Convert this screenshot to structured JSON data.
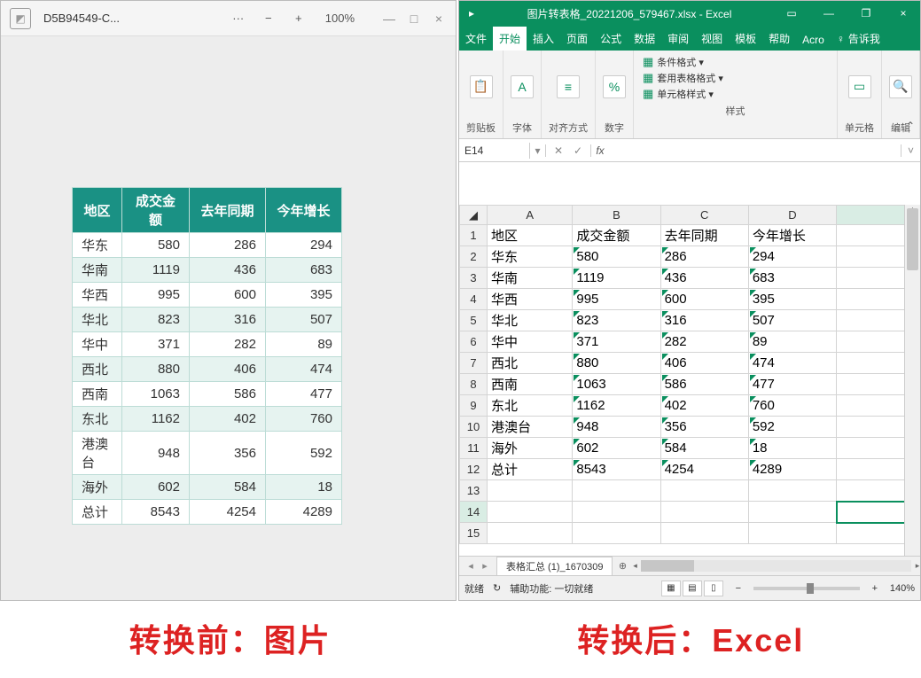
{
  "left": {
    "filename": "D5B94549-C...",
    "more": "···",
    "zoom_out": "−",
    "zoom_in": "+",
    "zoom": "100%",
    "min": "—",
    "max": "□",
    "close": "×",
    "table": {
      "headers": [
        "地区",
        "成交金额",
        "去年同期",
        "今年增长"
      ],
      "rows": [
        [
          "华东",
          "580",
          "286",
          "294"
        ],
        [
          "华南",
          "1119",
          "436",
          "683"
        ],
        [
          "华西",
          "995",
          "600",
          "395"
        ],
        [
          "华北",
          "823",
          "316",
          "507"
        ],
        [
          "华中",
          "371",
          "282",
          "89"
        ],
        [
          "西北",
          "880",
          "406",
          "474"
        ],
        [
          "西南",
          "1063",
          "586",
          "477"
        ],
        [
          "东北",
          "1162",
          "402",
          "760"
        ],
        [
          "港澳台",
          "948",
          "356",
          "592"
        ],
        [
          "海外",
          "602",
          "584",
          "18"
        ],
        [
          "总计",
          "8543",
          "4254",
          "4289"
        ]
      ]
    }
  },
  "excel": {
    "title": "图片转表格_20221206_579467.xlsx - Excel",
    "win_min": "—",
    "win_restore": "❐",
    "win_close": "×",
    "win_acct": "▭",
    "tabs": [
      "文件",
      "开始",
      "插入",
      "页面",
      "公式",
      "数据",
      "审阅",
      "视图",
      "模板",
      "帮助",
      "Acro"
    ],
    "tell_icon": "♀",
    "tell": "告诉我",
    "ribbon": {
      "clipboard": {
        "icon": "📋",
        "label": "剪贴板"
      },
      "font": {
        "icon": "A",
        "label": "字体"
      },
      "align": {
        "icon": "≡",
        "label": "对齐方式"
      },
      "number": {
        "icon": "%",
        "label": "数字"
      },
      "styles": {
        "cond": "条件格式 ▾",
        "table": "套用表格格式 ▾",
        "cell": "单元格样式 ▾",
        "label": "样式",
        "i1": "▦",
        "i2": "▦",
        "i3": "▦"
      },
      "cells": {
        "icon": "▭",
        "label": "单元格"
      },
      "edit": {
        "icon": "🔍",
        "label": "编辑"
      },
      "collapse": "⌃"
    },
    "namebox": {
      "cell": "E14",
      "drop": "▾",
      "cancel": "✕",
      "ok": "✓",
      "fx": "fx",
      "value": "",
      "expand": "˅"
    },
    "colheads": [
      "A",
      "B",
      "C",
      "D"
    ],
    "data": {
      "headers": [
        "地区",
        "成交金额",
        "去年同期",
        "今年增长"
      ],
      "rows": [
        [
          "华东",
          "580",
          "286",
          "294"
        ],
        [
          "华南",
          "1119",
          "436",
          "683"
        ],
        [
          "华西",
          "995",
          "600",
          "395"
        ],
        [
          "华北",
          "823",
          "316",
          "507"
        ],
        [
          "华中",
          "371",
          "282",
          "89"
        ],
        [
          "西北",
          "880",
          "406",
          "474"
        ],
        [
          "西南",
          "1063",
          "586",
          "477"
        ],
        [
          "东北",
          "1162",
          "402",
          "760"
        ],
        [
          "港澳台",
          "948",
          "356",
          "592"
        ],
        [
          "海外",
          "602",
          "584",
          "18"
        ],
        [
          "总计",
          "8543",
          "4254",
          "4289"
        ]
      ]
    },
    "rownums": [
      "1",
      "2",
      "3",
      "4",
      "5",
      "6",
      "7",
      "8",
      "9",
      "10",
      "11",
      "12",
      "13",
      "14",
      "15"
    ],
    "sheet": {
      "name": "表格汇总 (1)_1670309",
      "add": "⊕",
      "navl": "◂",
      "navr": "▸",
      "harrl": "◂",
      "harrr": "▸"
    },
    "status": {
      "ready": "就绪",
      "acc_icon": "↻",
      "acc": "辅助功能: 一切就绪",
      "zoom": "140%",
      "minus": "−",
      "plus": "+",
      "v1": "▦",
      "v2": "▤",
      "v3": "▯"
    },
    "scroll": {
      "up": "▴",
      "dn": "▾"
    }
  },
  "captions": {
    "before": "转换前：图片",
    "after": "转换后：Excel"
  }
}
